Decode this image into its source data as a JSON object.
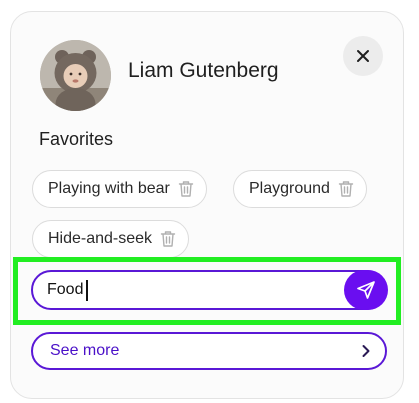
{
  "profile": {
    "name": "Liam Gutenberg",
    "avatar_icon": "child-in-bear-hood-photo"
  },
  "close_icon": "close-icon",
  "favorites": {
    "title": "Favorites",
    "items": [
      {
        "label": "Playing with bear"
      },
      {
        "label": "Playground"
      },
      {
        "label": "Hide-and-seek"
      }
    ],
    "delete_icon": "trash-icon"
  },
  "input": {
    "value": "Food",
    "placeholder": ""
  },
  "send_icon": "send-icon",
  "see_more": {
    "label": "See more",
    "icon": "chevron-right-icon"
  },
  "colors": {
    "accent": "#6a0ef0",
    "accent_border": "#5a18d6",
    "highlight": "#22ee22"
  }
}
